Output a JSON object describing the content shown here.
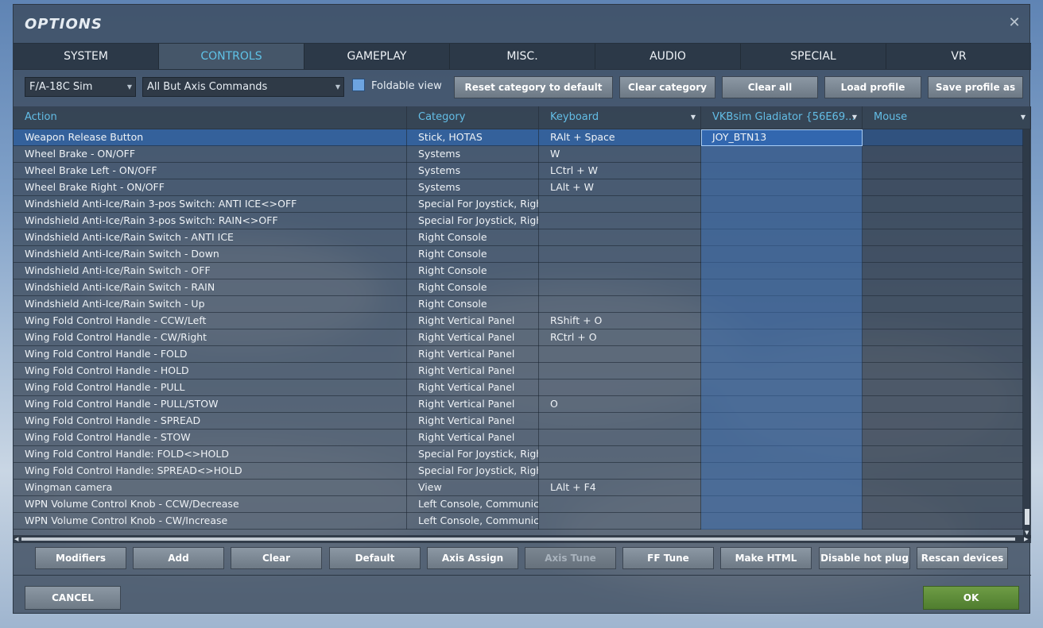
{
  "window": {
    "title": "OPTIONS"
  },
  "tabs": [
    {
      "label": "SYSTEM",
      "active": false
    },
    {
      "label": "CONTROLS",
      "active": true
    },
    {
      "label": "GAMEPLAY",
      "active": false
    },
    {
      "label": "MISC.",
      "active": false
    },
    {
      "label": "AUDIO",
      "active": false
    },
    {
      "label": "SPECIAL",
      "active": false
    },
    {
      "label": "VR",
      "active": false
    }
  ],
  "toolbar": {
    "aircraft_select": "F/A-18C Sim",
    "filter_select": "All But Axis Commands",
    "foldable_view_label": "Foldable view",
    "foldable_view_checked": true,
    "reset_category": "Reset category to default",
    "clear_category": "Clear category",
    "clear_all": "Clear all",
    "load_profile": "Load profile",
    "save_profile_as": "Save profile as"
  },
  "table": {
    "columns": {
      "action": "Action",
      "category": "Category",
      "keyboard": "Keyboard",
      "joystick": "VKBsim Gladiator  {56E69...",
      "mouse": "Mouse"
    },
    "rows": [
      {
        "action": "Weapon Release Button",
        "category": "Stick, HOTAS",
        "keyboard": "RAlt + Space",
        "joystick": "JOY_BTN13",
        "mouse": "",
        "selected": true
      },
      {
        "action": "Wheel Brake - ON/OFF",
        "category": "Systems",
        "keyboard": "W",
        "joystick": "",
        "mouse": ""
      },
      {
        "action": "Wheel Brake Left - ON/OFF",
        "category": "Systems",
        "keyboard": "LCtrl + W",
        "joystick": "",
        "mouse": ""
      },
      {
        "action": "Wheel Brake Right - ON/OFF",
        "category": "Systems",
        "keyboard": "LAlt + W",
        "joystick": "",
        "mouse": ""
      },
      {
        "action": "Windshield Anti-Ice/Rain 3-pos Switch: ANTI ICE<>OFF",
        "category": "Special For Joystick, Right",
        "keyboard": "",
        "joystick": "",
        "mouse": ""
      },
      {
        "action": "Windshield Anti-Ice/Rain 3-pos Switch: RAIN<>OFF",
        "category": "Special For Joystick, Right",
        "keyboard": "",
        "joystick": "",
        "mouse": ""
      },
      {
        "action": "Windshield Anti-Ice/Rain Switch - ANTI ICE",
        "category": "Right Console",
        "keyboard": "",
        "joystick": "",
        "mouse": ""
      },
      {
        "action": "Windshield Anti-Ice/Rain Switch - Down",
        "category": "Right Console",
        "keyboard": "",
        "joystick": "",
        "mouse": ""
      },
      {
        "action": "Windshield Anti-Ice/Rain Switch - OFF",
        "category": "Right Console",
        "keyboard": "",
        "joystick": "",
        "mouse": ""
      },
      {
        "action": "Windshield Anti-Ice/Rain Switch - RAIN",
        "category": "Right Console",
        "keyboard": "",
        "joystick": "",
        "mouse": ""
      },
      {
        "action": "Windshield Anti-Ice/Rain Switch - Up",
        "category": "Right Console",
        "keyboard": "",
        "joystick": "",
        "mouse": ""
      },
      {
        "action": "Wing Fold Control Handle - CCW/Left",
        "category": "Right Vertical Panel",
        "keyboard": "RShift + O",
        "joystick": "",
        "mouse": ""
      },
      {
        "action": "Wing Fold Control Handle - CW/Right",
        "category": "Right Vertical Panel",
        "keyboard": "RCtrl + O",
        "joystick": "",
        "mouse": ""
      },
      {
        "action": "Wing Fold Control Handle - FOLD",
        "category": "Right Vertical Panel",
        "keyboard": "",
        "joystick": "",
        "mouse": ""
      },
      {
        "action": "Wing Fold Control Handle - HOLD",
        "category": "Right Vertical Panel",
        "keyboard": "",
        "joystick": "",
        "mouse": ""
      },
      {
        "action": "Wing Fold Control Handle - PULL",
        "category": "Right Vertical Panel",
        "keyboard": "",
        "joystick": "",
        "mouse": ""
      },
      {
        "action": "Wing Fold Control Handle - PULL/STOW",
        "category": "Right Vertical Panel",
        "keyboard": "O",
        "joystick": "",
        "mouse": ""
      },
      {
        "action": "Wing Fold Control Handle - SPREAD",
        "category": "Right Vertical Panel",
        "keyboard": "",
        "joystick": "",
        "mouse": ""
      },
      {
        "action": "Wing Fold Control Handle - STOW",
        "category": "Right Vertical Panel",
        "keyboard": "",
        "joystick": "",
        "mouse": ""
      },
      {
        "action": "Wing Fold Control Handle: FOLD<>HOLD",
        "category": "Special For Joystick, Right",
        "keyboard": "",
        "joystick": "",
        "mouse": ""
      },
      {
        "action": "Wing Fold Control Handle: SPREAD<>HOLD",
        "category": "Special For Joystick, Right",
        "keyboard": "",
        "joystick": "",
        "mouse": ""
      },
      {
        "action": "Wingman camera",
        "category": "View",
        "keyboard": "LAlt + F4",
        "joystick": "",
        "mouse": ""
      },
      {
        "action": "WPN Volume Control Knob - CCW/Decrease",
        "category": "Left Console, Communicat",
        "keyboard": "",
        "joystick": "",
        "mouse": ""
      },
      {
        "action": "WPN Volume Control Knob - CW/Increase",
        "category": "Left Console, Communicat",
        "keyboard": "",
        "joystick": "",
        "mouse": ""
      }
    ]
  },
  "bottom_buttons": [
    {
      "label": "Modifiers",
      "name": "modifiers-button",
      "disabled": false
    },
    {
      "label": "Add",
      "name": "add-button",
      "disabled": false
    },
    {
      "label": "Clear",
      "name": "clear-button",
      "disabled": false
    },
    {
      "label": "Default",
      "name": "default-button",
      "disabled": false
    },
    {
      "label": "Axis Assign",
      "name": "axis-assign-button",
      "disabled": false
    },
    {
      "label": "Axis Tune",
      "name": "axis-tune-button",
      "disabled": true
    },
    {
      "label": "FF Tune",
      "name": "ff-tune-button",
      "disabled": false
    },
    {
      "label": "Make HTML",
      "name": "make-html-button",
      "disabled": false
    },
    {
      "label": "Disable hot plug",
      "name": "disable-hot-plug-button",
      "disabled": false
    },
    {
      "label": "Rescan devices",
      "name": "rescan-devices-button",
      "disabled": false
    }
  ],
  "footer": {
    "cancel": "CANCEL",
    "ok": "OK"
  },
  "icons": {
    "close": "close-icon",
    "dropdown": "chevron-down-icon"
  },
  "colors": {
    "accent": "#5fc3e8",
    "selected_row": "#2d64aa",
    "ok_button": "#5a8a38"
  }
}
